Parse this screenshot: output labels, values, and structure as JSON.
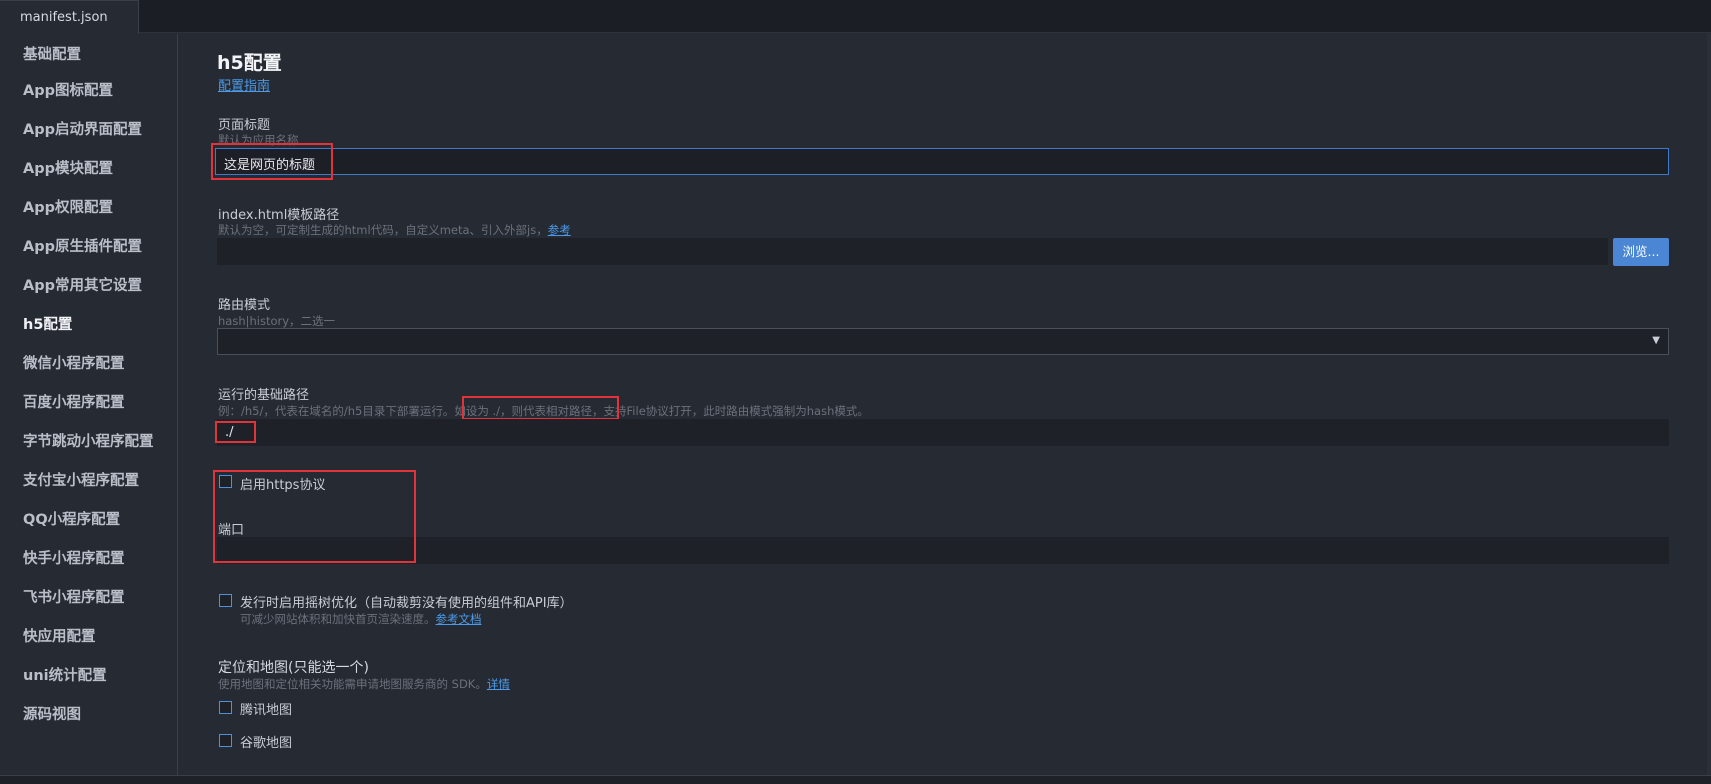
{
  "tab": {
    "label": "manifest.json"
  },
  "sidebar": {
    "items": [
      {
        "label": "基础配置"
      },
      {
        "label": "App图标配置"
      },
      {
        "label": "App启动界面配置"
      },
      {
        "label": "App模块配置"
      },
      {
        "label": "App权限配置"
      },
      {
        "label": "App原生插件配置"
      },
      {
        "label": "App常用其它设置"
      },
      {
        "label": "h5配置"
      },
      {
        "label": "微信小程序配置"
      },
      {
        "label": "百度小程序配置"
      },
      {
        "label": "字节跳动小程序配置"
      },
      {
        "label": "支付宝小程序配置"
      },
      {
        "label": "QQ小程序配置"
      },
      {
        "label": "快手小程序配置"
      },
      {
        "label": "飞书小程序配置"
      },
      {
        "label": "快应用配置"
      },
      {
        "label": "uni统计配置"
      },
      {
        "label": "源码视图"
      }
    ],
    "active": "h5配置"
  },
  "main": {
    "title": "h5配置",
    "guide_link": "配置指南",
    "page_title": {
      "label": "页面标题",
      "hint": "默认为应用名称",
      "value": "这是网页的标题"
    },
    "template": {
      "label": "index.html模板路径",
      "hint": "默认为空，可定制生成的html代码，自定义meta、引入外部js，",
      "hint_link": "参考",
      "value": "",
      "browse": "浏览..."
    },
    "router": {
      "label": "路由模式",
      "hint": "hash|history，二选一",
      "value": ""
    },
    "base_path": {
      "label": "运行的基础路径",
      "hint_a": "例：/h5/，代表在域名的/h5目录下部署运行。",
      "hint_b": "如设为 ./，则代表相对路径，",
      "hint_c": "支持File协议打开，此时路由模式强制为hash模式。",
      "value": "./"
    },
    "https": {
      "label": "启用https协议",
      "checked": false
    },
    "port": {
      "label": "端口",
      "value": ""
    },
    "treeshake": {
      "label": "发行时启用摇树优化（自动裁剪没有使用的组件和API库）",
      "hint": "可减少网站体积和加快首页渲染速度。",
      "hint_link": "参考文档",
      "checked": false
    },
    "map": {
      "title": "定位和地图(只能选一个)",
      "hint": "使用地图和定位相关功能需申请地图服务商的 SDK。",
      "hint_link": "详情",
      "options": [
        {
          "label": "腾讯地图",
          "checked": false
        },
        {
          "label": "谷歌地图",
          "checked": false
        }
      ]
    }
  },
  "colors": {
    "background": "#262a33",
    "accent": "#4a86d4",
    "link": "#4b9bea",
    "highlight_box": "#e0343a"
  }
}
